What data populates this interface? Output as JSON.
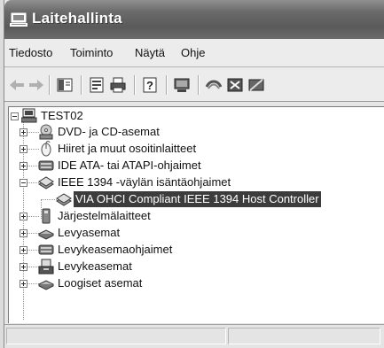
{
  "window": {
    "title": "Laitehallinta",
    "title_icon": "computer-icon"
  },
  "menu": {
    "file": "Tiedosto",
    "action": "Toiminto",
    "view": "Näytä",
    "help": "Ohje"
  },
  "toolbar": {
    "buttons": [
      "back-arrow-icon",
      "forward-arrow-icon",
      "show-hide-tree-icon",
      "properties-icon",
      "print-icon",
      "help-icon",
      "scan-hardware-icon",
      "update-driver-icon",
      "uninstall-icon",
      "disable-icon"
    ]
  },
  "tree": {
    "root": "TEST02",
    "items": [
      {
        "label": "DVD- ja CD-asemat",
        "icon": "cd-drive-icon",
        "expanded": false
      },
      {
        "label": "Hiiret ja muut osoitinlaitteet",
        "icon": "mouse-icon",
        "expanded": false
      },
      {
        "label": "IDE ATA- tai ATAPI-ohjaimet",
        "icon": "ide-controller-icon",
        "expanded": false
      },
      {
        "label": "IEEE 1394 -väylän isäntäohjaimet",
        "icon": "ieee1394-icon",
        "expanded": true,
        "children": [
          {
            "label": "VIA OHCI Compliant IEEE 1394 Host Controller",
            "icon": "ieee1394-device-icon",
            "selected": true
          }
        ]
      },
      {
        "label": "Järjestelmälaitteet",
        "icon": "system-devices-icon",
        "expanded": false
      },
      {
        "label": "Levyasemat",
        "icon": "floppy-drive-icon",
        "expanded": false
      },
      {
        "label": "Levykeasemaohjaimet",
        "icon": "floppy-controller-icon",
        "expanded": false
      },
      {
        "label": "Levykeasemat",
        "icon": "disk-drive-icon",
        "expanded": false
      },
      {
        "label": "Loogiset asemat",
        "icon": "logical-drive-icon",
        "expanded": false
      }
    ]
  },
  "colors": {
    "selection_bg": "#3c3c3c",
    "titlebar": "#6a6a6a"
  }
}
